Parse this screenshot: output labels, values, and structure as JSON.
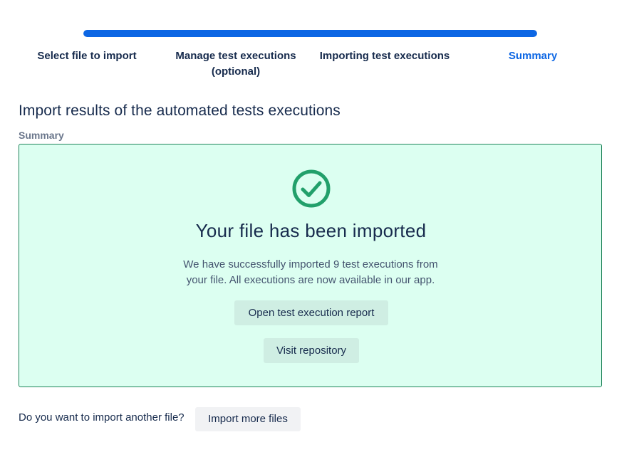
{
  "stepper": {
    "progress_percent": 100,
    "steps": [
      {
        "label": "Select file to import",
        "active": false
      },
      {
        "label": "Manage test executions (optional)",
        "active": false
      },
      {
        "label": "Importing test executions",
        "active": false
      },
      {
        "label": "Summary",
        "active": true
      }
    ]
  },
  "header": {
    "title": "Import results of the automated tests executions",
    "section_label": "Summary"
  },
  "summary_card": {
    "icon": "check-circle-icon",
    "heading": "Your file has been imported",
    "message": "We have successfully imported 9 test executions from your file. All executions are now available in our app.",
    "open_report_label": "Open test execution report",
    "visit_repository_label": "Visit repository"
  },
  "footer": {
    "question": "Do you want to import another file?",
    "import_more_label": "Import more files"
  },
  "colors": {
    "accent": "#0c66e4",
    "success_border": "#1f845a",
    "success_background": "#dcfff1",
    "success_icon": "#22a06b",
    "text": "#172b4d"
  }
}
